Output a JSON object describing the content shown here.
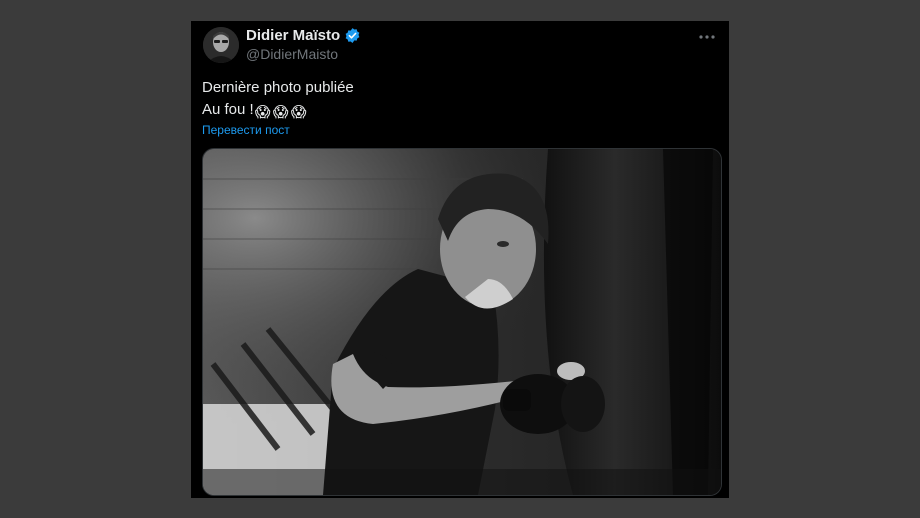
{
  "tweet": {
    "author": {
      "display_name": "Didier Maïsto",
      "handle": "@DidierMaisto",
      "verified_icon": "verified-badge-icon",
      "avatar_icon": "profile-photo"
    },
    "text_line1": "Dernière photo publiée",
    "text_line2": "Au fou !",
    "emoji": [
      "😱",
      "😱",
      "😱"
    ],
    "translate_label": "Перевести пост",
    "more_icon": "more-options-icon",
    "media_icon": "boxing-photo"
  },
  "colors": {
    "background": "#3b3b3b",
    "card": "#000000",
    "text": "#e7e9ea",
    "muted": "#71767b",
    "link": "#1d9bf0",
    "verified": "#1d9bf0"
  }
}
